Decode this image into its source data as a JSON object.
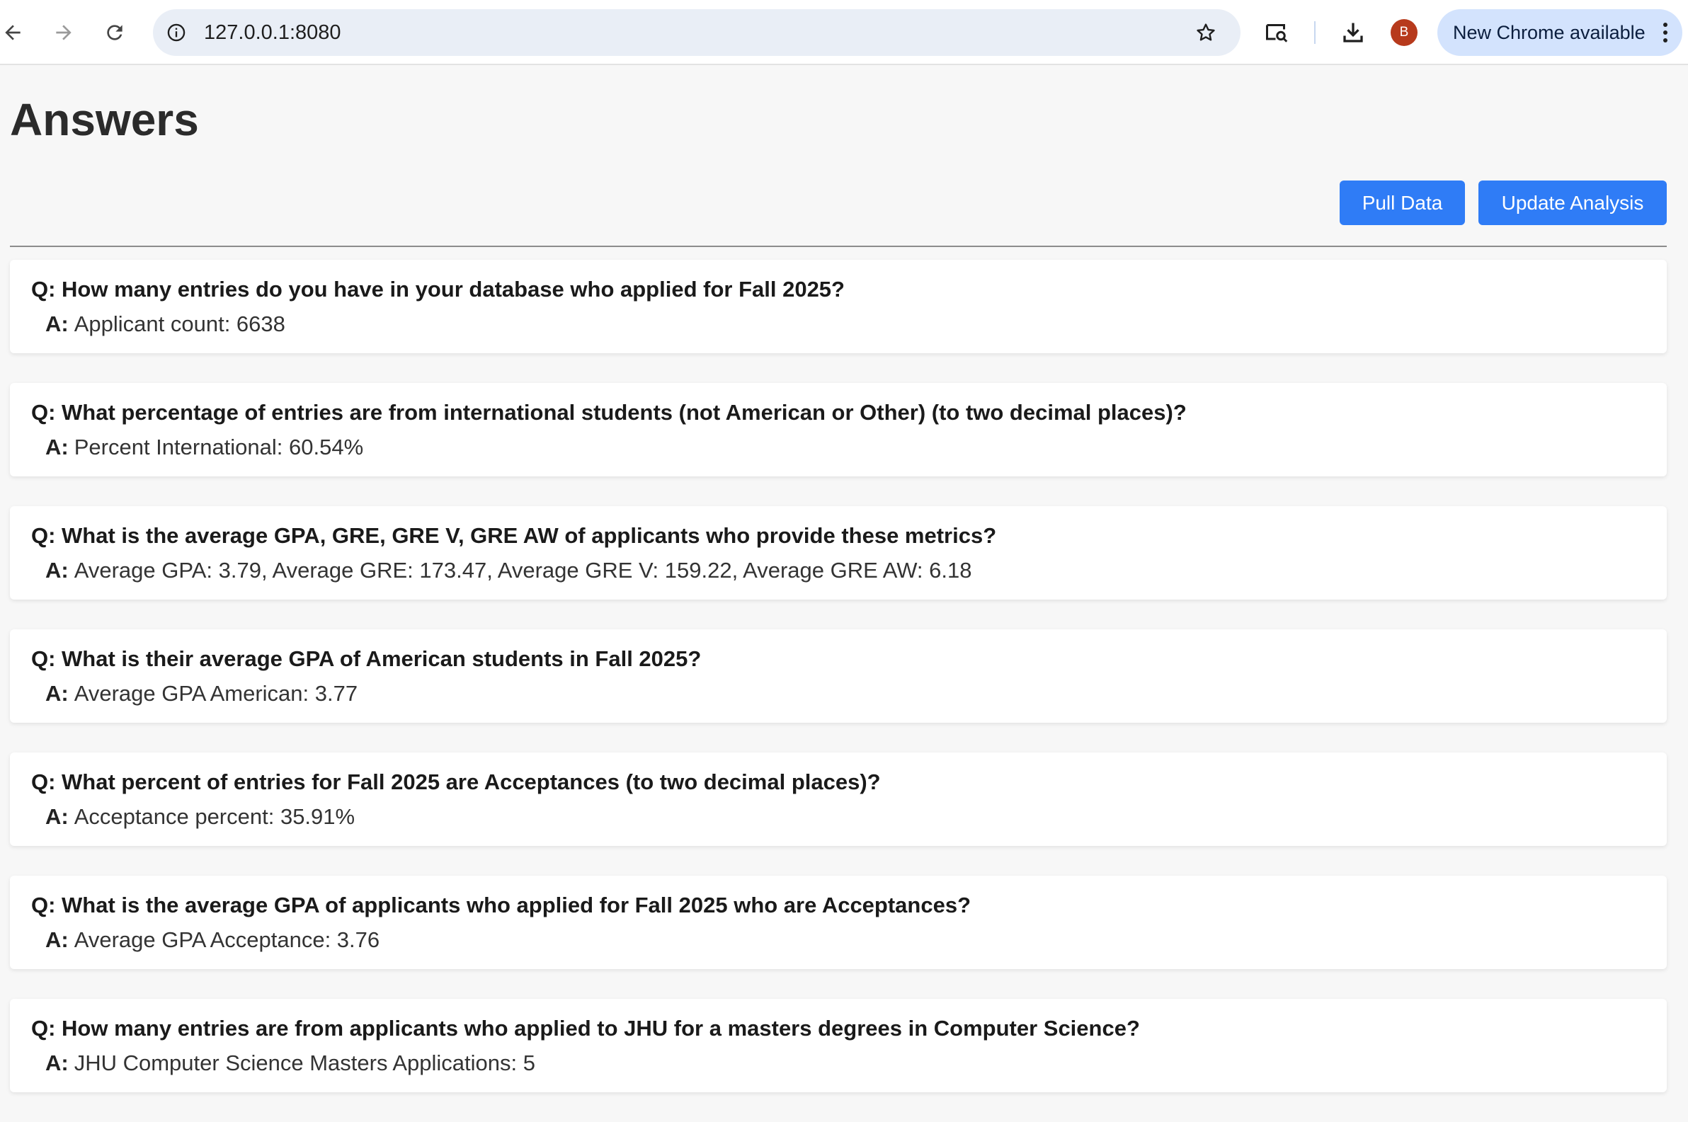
{
  "browser": {
    "url": "127.0.0.1:8080",
    "profile_initial": "B",
    "update_label": "New Chrome available",
    "icons": [
      "back-arrow-icon",
      "forward-arrow-icon",
      "reload-icon",
      "site-info-icon",
      "bookmark-star-icon",
      "search-tab-icon",
      "download-icon",
      "more-vert-icon"
    ],
    "colors": {
      "omnibox": "#e9eef6",
      "update_pill": "#d3e3fd",
      "avatar": "#b73a1c"
    }
  },
  "page": {
    "title": "Answers",
    "pull_label": "Pull Data",
    "update_label": "Update Analysis",
    "answer_prefix": "A:",
    "colors": {
      "button": "#2f7cf6",
      "background": "#f7f7f7",
      "card": "#ffffff"
    }
  },
  "qa": [
    {
      "q": "Q: How many entries do you have in your database who applied for Fall 2025?",
      "a": "Applicant count: 6638"
    },
    {
      "q": "Q: What percentage of entries are from international students (not American or Other) (to two decimal places)?",
      "a": "Percent International: 60.54%"
    },
    {
      "q": "Q: What is the average GPA, GRE, GRE V, GRE AW of applicants who provide these metrics?",
      "a": "Average GPA: 3.79, Average GRE: 173.47, Average GRE V: 159.22, Average GRE AW: 6.18"
    },
    {
      "q": "Q: What is their average GPA of American students in Fall 2025?",
      "a": "Average GPA American: 3.77"
    },
    {
      "q": "Q: What percent of entries for Fall 2025 are Acceptances (to two decimal places)?",
      "a": "Acceptance percent: 35.91%"
    },
    {
      "q": "Q: What is the average GPA of applicants who applied for Fall 2025 who are Acceptances?",
      "a": "Average GPA Acceptance: 3.76"
    },
    {
      "q": "Q: How many entries are from applicants who applied to JHU for a masters degrees in Computer Science?",
      "a": "JHU Computer Science Masters Applications: 5"
    }
  ]
}
